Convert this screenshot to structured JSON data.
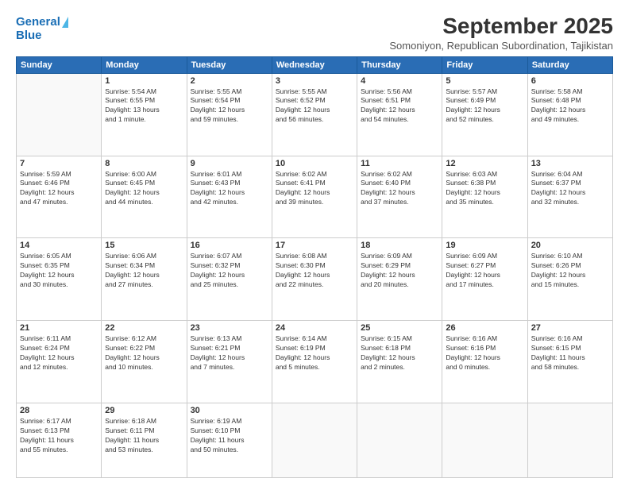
{
  "logo": {
    "line1": "General",
    "line2": "Blue"
  },
  "title": "September 2025",
  "location": "Somoniyon, Republican Subordination, Tajikistan",
  "weekdays": [
    "Sunday",
    "Monday",
    "Tuesday",
    "Wednesday",
    "Thursday",
    "Friday",
    "Saturday"
  ],
  "weeks": [
    [
      {
        "day": "",
        "info": ""
      },
      {
        "day": "1",
        "info": "Sunrise: 5:54 AM\nSunset: 6:55 PM\nDaylight: 13 hours\nand 1 minute."
      },
      {
        "day": "2",
        "info": "Sunrise: 5:55 AM\nSunset: 6:54 PM\nDaylight: 12 hours\nand 59 minutes."
      },
      {
        "day": "3",
        "info": "Sunrise: 5:55 AM\nSunset: 6:52 PM\nDaylight: 12 hours\nand 56 minutes."
      },
      {
        "day": "4",
        "info": "Sunrise: 5:56 AM\nSunset: 6:51 PM\nDaylight: 12 hours\nand 54 minutes."
      },
      {
        "day": "5",
        "info": "Sunrise: 5:57 AM\nSunset: 6:49 PM\nDaylight: 12 hours\nand 52 minutes."
      },
      {
        "day": "6",
        "info": "Sunrise: 5:58 AM\nSunset: 6:48 PM\nDaylight: 12 hours\nand 49 minutes."
      }
    ],
    [
      {
        "day": "7",
        "info": "Sunrise: 5:59 AM\nSunset: 6:46 PM\nDaylight: 12 hours\nand 47 minutes."
      },
      {
        "day": "8",
        "info": "Sunrise: 6:00 AM\nSunset: 6:45 PM\nDaylight: 12 hours\nand 44 minutes."
      },
      {
        "day": "9",
        "info": "Sunrise: 6:01 AM\nSunset: 6:43 PM\nDaylight: 12 hours\nand 42 minutes."
      },
      {
        "day": "10",
        "info": "Sunrise: 6:02 AM\nSunset: 6:41 PM\nDaylight: 12 hours\nand 39 minutes."
      },
      {
        "day": "11",
        "info": "Sunrise: 6:02 AM\nSunset: 6:40 PM\nDaylight: 12 hours\nand 37 minutes."
      },
      {
        "day": "12",
        "info": "Sunrise: 6:03 AM\nSunset: 6:38 PM\nDaylight: 12 hours\nand 35 minutes."
      },
      {
        "day": "13",
        "info": "Sunrise: 6:04 AM\nSunset: 6:37 PM\nDaylight: 12 hours\nand 32 minutes."
      }
    ],
    [
      {
        "day": "14",
        "info": "Sunrise: 6:05 AM\nSunset: 6:35 PM\nDaylight: 12 hours\nand 30 minutes."
      },
      {
        "day": "15",
        "info": "Sunrise: 6:06 AM\nSunset: 6:34 PM\nDaylight: 12 hours\nand 27 minutes."
      },
      {
        "day": "16",
        "info": "Sunrise: 6:07 AM\nSunset: 6:32 PM\nDaylight: 12 hours\nand 25 minutes."
      },
      {
        "day": "17",
        "info": "Sunrise: 6:08 AM\nSunset: 6:30 PM\nDaylight: 12 hours\nand 22 minutes."
      },
      {
        "day": "18",
        "info": "Sunrise: 6:09 AM\nSunset: 6:29 PM\nDaylight: 12 hours\nand 20 minutes."
      },
      {
        "day": "19",
        "info": "Sunrise: 6:09 AM\nSunset: 6:27 PM\nDaylight: 12 hours\nand 17 minutes."
      },
      {
        "day": "20",
        "info": "Sunrise: 6:10 AM\nSunset: 6:26 PM\nDaylight: 12 hours\nand 15 minutes."
      }
    ],
    [
      {
        "day": "21",
        "info": "Sunrise: 6:11 AM\nSunset: 6:24 PM\nDaylight: 12 hours\nand 12 minutes."
      },
      {
        "day": "22",
        "info": "Sunrise: 6:12 AM\nSunset: 6:22 PM\nDaylight: 12 hours\nand 10 minutes."
      },
      {
        "day": "23",
        "info": "Sunrise: 6:13 AM\nSunset: 6:21 PM\nDaylight: 12 hours\nand 7 minutes."
      },
      {
        "day": "24",
        "info": "Sunrise: 6:14 AM\nSunset: 6:19 PM\nDaylight: 12 hours\nand 5 minutes."
      },
      {
        "day": "25",
        "info": "Sunrise: 6:15 AM\nSunset: 6:18 PM\nDaylight: 12 hours\nand 2 minutes."
      },
      {
        "day": "26",
        "info": "Sunrise: 6:16 AM\nSunset: 6:16 PM\nDaylight: 12 hours\nand 0 minutes."
      },
      {
        "day": "27",
        "info": "Sunrise: 6:16 AM\nSunset: 6:15 PM\nDaylight: 11 hours\nand 58 minutes."
      }
    ],
    [
      {
        "day": "28",
        "info": "Sunrise: 6:17 AM\nSunset: 6:13 PM\nDaylight: 11 hours\nand 55 minutes."
      },
      {
        "day": "29",
        "info": "Sunrise: 6:18 AM\nSunset: 6:11 PM\nDaylight: 11 hours\nand 53 minutes."
      },
      {
        "day": "30",
        "info": "Sunrise: 6:19 AM\nSunset: 6:10 PM\nDaylight: 11 hours\nand 50 minutes."
      },
      {
        "day": "",
        "info": ""
      },
      {
        "day": "",
        "info": ""
      },
      {
        "day": "",
        "info": ""
      },
      {
        "day": "",
        "info": ""
      }
    ]
  ]
}
